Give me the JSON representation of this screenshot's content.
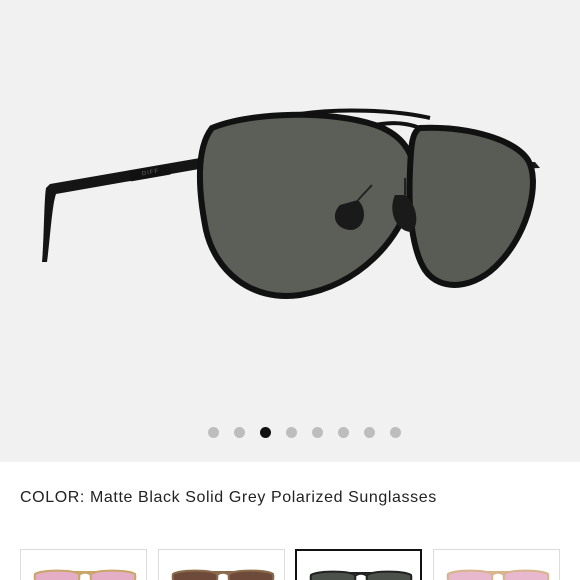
{
  "product": {
    "image_alt": "Matte Black Solid Grey Polarized Sunglasses",
    "brand_mark": "DIFF"
  },
  "carousel": {
    "count": 8,
    "active_index": 2
  },
  "color": {
    "label": "COLOR:",
    "value": "Matte Black Solid Grey Polarized Sunglasses"
  },
  "swatches": [
    {
      "name": "gold-rose-lens",
      "frame": "#c9a56a",
      "lens": "#e3aec6"
    },
    {
      "name": "brown-lens",
      "frame": "#8a6a4a",
      "lens": "#6e4a3a"
    },
    {
      "name": "black-grey-lens",
      "frame": "#222222",
      "lens": "#4c524b",
      "selected": true
    },
    {
      "name": "rose-gold-lens",
      "frame": "#d6b48c",
      "lens": "#e8b8cf"
    }
  ]
}
